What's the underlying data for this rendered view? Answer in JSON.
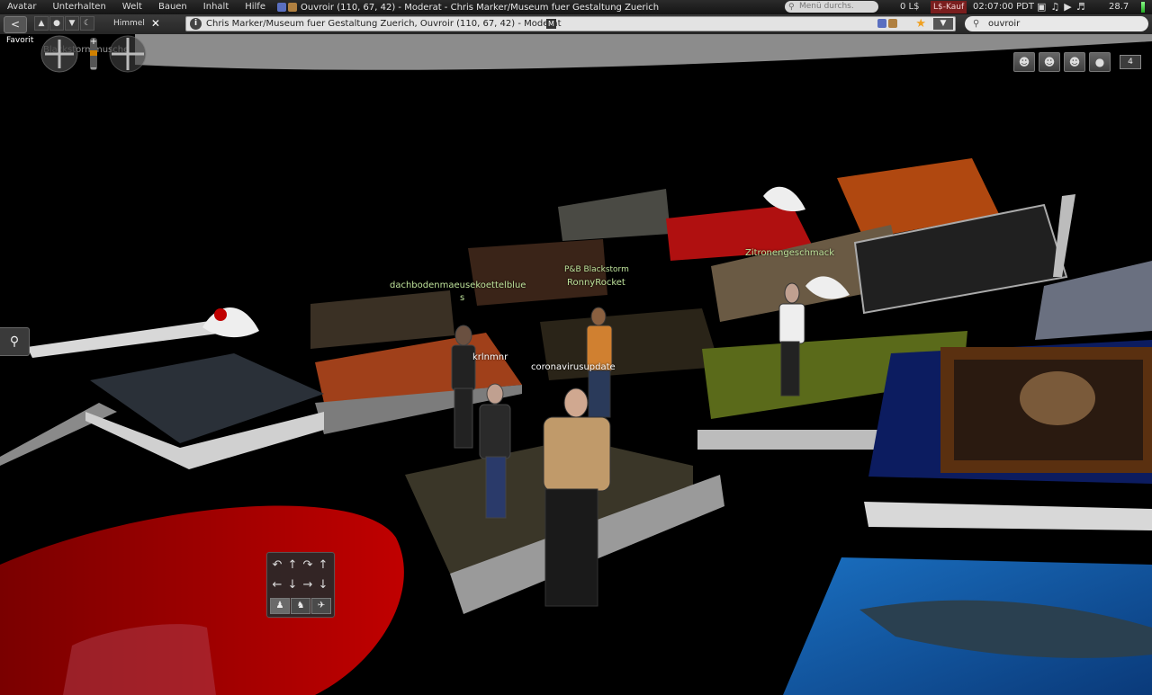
{
  "menubar": {
    "items": [
      "Avatar",
      "Unterhalten",
      "Welt",
      "Bauen",
      "Inhalt",
      "Hilfe"
    ],
    "location_title": "Ouvroir (110, 67, 42) - Moderat - Chris Marker/Museum fuer Gestaltung Zuerich",
    "search_placeholder": "Menü durchs.",
    "balance": "0 L$",
    "buy_currency": "L$-Kauf",
    "clock": "02:07:00 PDT",
    "fps": "28.7"
  },
  "navbar": {
    "back_label": "<",
    "location": "Chris Marker/Museum fuer Gestaltung Zuerich, Ouvroir (110, 67, 42) - Moderat",
    "maturity_badge": "M",
    "search_value": "ouvroir"
  },
  "overlays": {
    "favorites_label": "Favorit",
    "camera_text": "Blackstormmusche",
    "sky_label": "Himmel",
    "nearby_count": "4"
  },
  "name_tags": [
    {
      "text": "dachbodenmaeusekoettelblue",
      "color": "green"
    },
    {
      "text": "s",
      "color": "green"
    },
    {
      "text": "P&B Blackstorm",
      "color": "green"
    },
    {
      "text": "RonnyRocket",
      "color": "green"
    },
    {
      "text": "Zitronengeschmack",
      "color": "green"
    },
    {
      "text": "krlnmnr",
      "color": "white"
    },
    {
      "text": "coronavirusupdate",
      "color": "white"
    }
  ],
  "icons": {
    "search": "search-icon",
    "info": "info-icon",
    "star": "landmark-star-icon",
    "minimap": "map-pin-icon"
  },
  "colors": {
    "accent_red": "#c00000",
    "buy_bg": "#7a1e1e",
    "star": "#f0a020"
  }
}
